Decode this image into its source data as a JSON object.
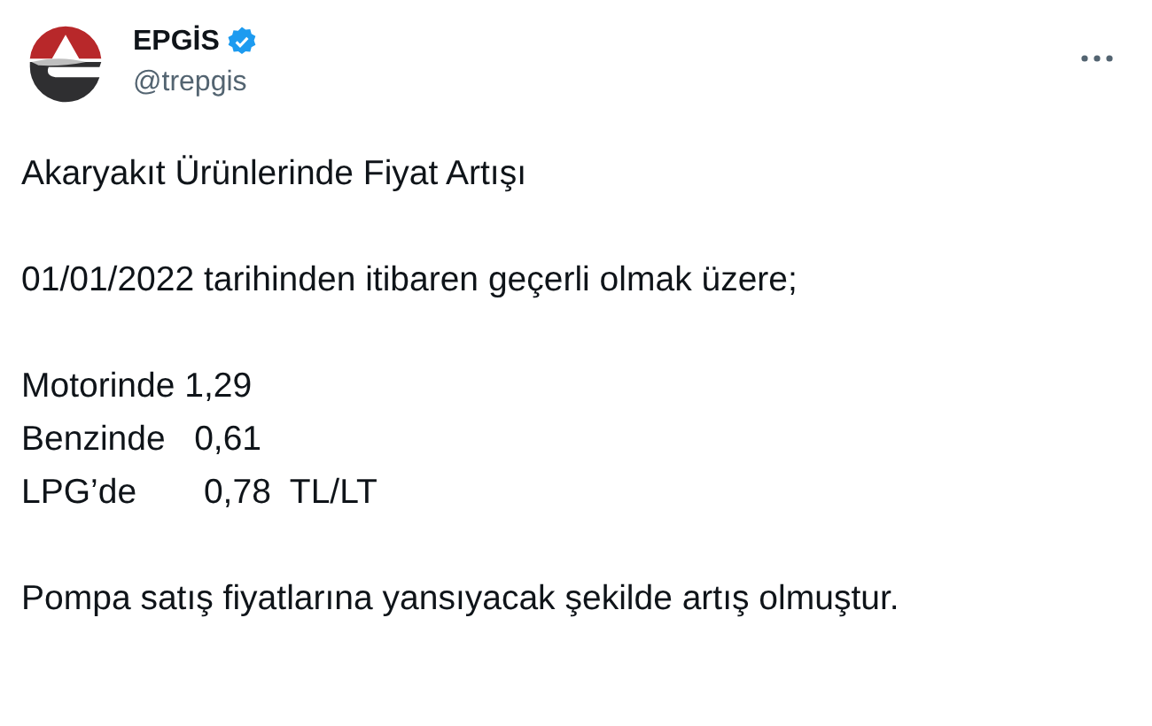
{
  "author": {
    "name": "EPGİS",
    "handle": "@trepgis",
    "verified": true
  },
  "body": [
    {
      "kind": "line",
      "text": "Akaryakıt Ürünlerinde Fiyat Artışı"
    },
    {
      "kind": "line",
      "text": "01/01/2022 tarihinden itibaren geçerli olmak üzere;"
    },
    {
      "kind": "block",
      "lines": [
        "Motorinde 1,29",
        "Benzinde   0,61",
        "LPG’de       0,78  TL/LT"
      ]
    },
    {
      "kind": "line",
      "text": "Pompa satış fiyatlarına yansıyacak şekilde artış olmuştur."
    }
  ]
}
